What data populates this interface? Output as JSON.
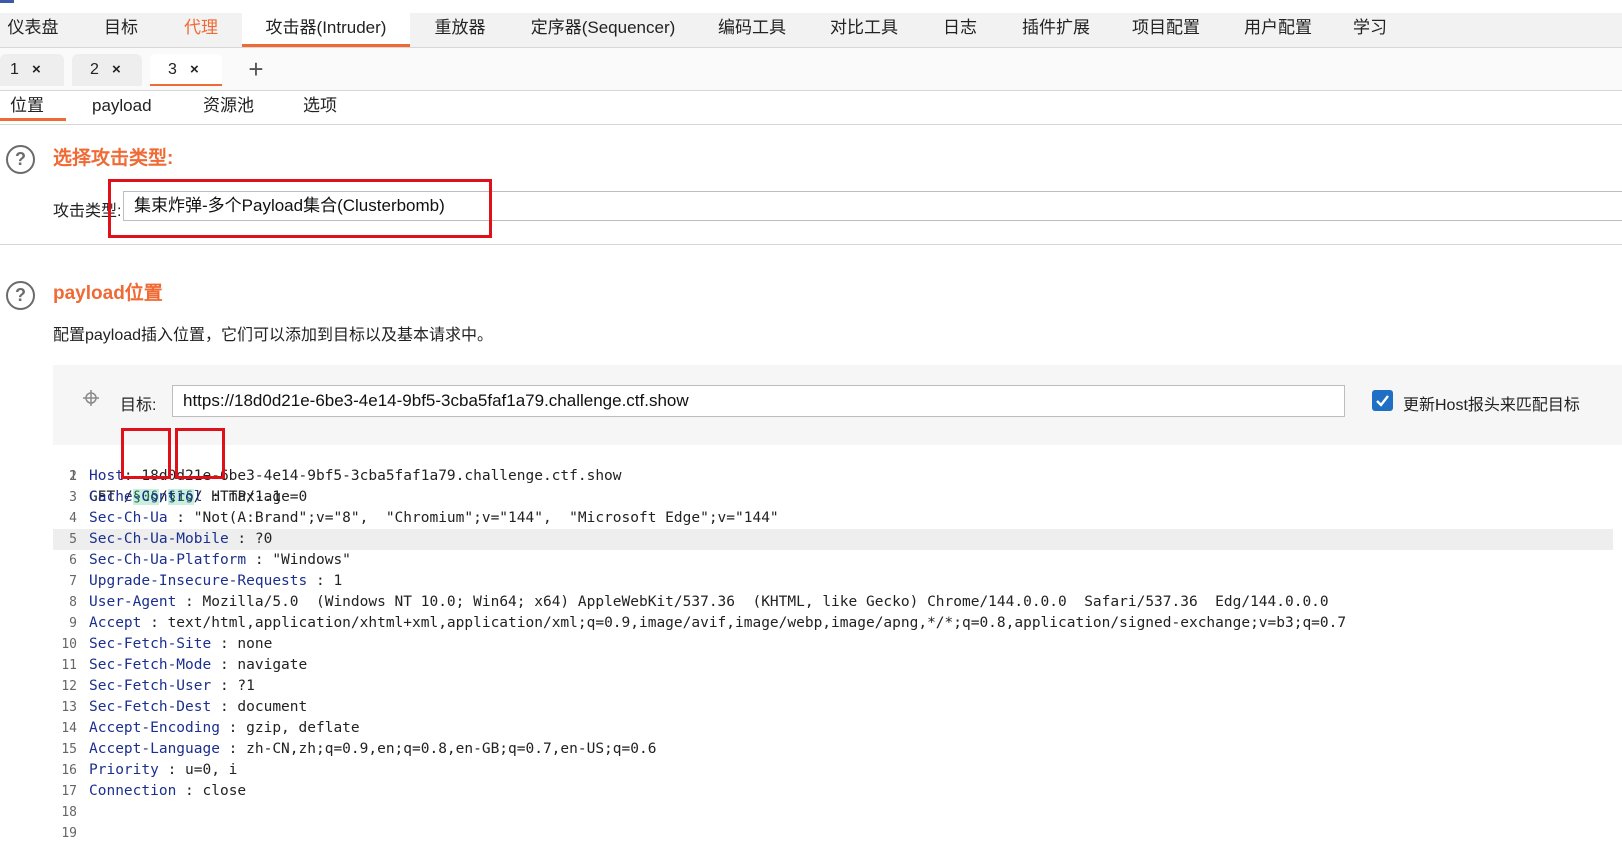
{
  "main_tabs": [
    "仪表盘",
    "目标",
    "代理",
    "攻击器(Intruder)",
    "重放器",
    "定序器(Sequencer)",
    "编码工具",
    "对比工具",
    "日志",
    "插件扩展",
    "项目配置",
    "用户配置",
    "学习"
  ],
  "num_tabs": [
    {
      "label": "1",
      "close": "×"
    },
    {
      "label": "2",
      "close": "×"
    },
    {
      "label": "3",
      "close": "×"
    }
  ],
  "add_tab": "+",
  "sub_tabs": [
    "位置",
    "payload",
    "资源池",
    "选项"
  ],
  "attack_section": {
    "help": "?",
    "title": "选择攻击类型:",
    "label": "攻击类型:",
    "value": "集束炸弹-多个Payload集合(Clusterbomb)"
  },
  "payload_section": {
    "help": "?",
    "title": "payload位置",
    "description": "配置payload插入位置，它们可以添加到目标以及基本请求中。"
  },
  "target": {
    "label": "目标:",
    "value": "https://18d0d21e-6be3-4e14-9bf5-3cba5faf1a79.challenge.ctf.show",
    "update_host_checked": true,
    "update_host_label": "更新Host报头来匹配目标"
  },
  "request": {
    "line1": {
      "ln": "1",
      "method": "GET /",
      "marker1": "§0§",
      "sep": "/",
      "marker2": "§1§",
      "rest": "/ HTTP/1.1"
    },
    "headers": [
      {
        "ln": "2",
        "name": "Host",
        "value": ": 18d0d21e-6be3-4e14-9bf5-3cba5faf1a79.challenge.ctf.show"
      },
      {
        "ln": "3",
        "name": "Cache-Control",
        "value": " : max-age=0"
      },
      {
        "ln": "4",
        "name": "Sec-Ch-Ua",
        "value": " : \"Not(A:Brand\";v=\"8\",  \"Chromium\";v=\"144\",  \"Microsoft Edge\";v=\"144\""
      },
      {
        "ln": "5",
        "name": "Sec-Ch-Ua-Mobile",
        "value": " : ?0"
      },
      {
        "ln": "6",
        "name": "Sec-Ch-Ua-Platform",
        "value": " : \"Windows\""
      },
      {
        "ln": "7",
        "name": "Upgrade-Insecure-Requests",
        "value": " : 1"
      },
      {
        "ln": "8",
        "name": "User-Agent",
        "value": " : Mozilla/5.0  (Windows NT 10.0; Win64; x64) AppleWebKit/537.36  (KHTML, like Gecko) Chrome/144.0.0.0  Safari/537.36  Edg/144.0.0.0"
      },
      {
        "ln": "9",
        "name": "Accept",
        "value": " : text/html,application/xhtml+xml,application/xml;q=0.9,image/avif,image/webp,image/apng,*/*;q=0.8,application/signed-exchange;v=b3;q=0.7"
      },
      {
        "ln": "10",
        "name": "Sec-Fetch-Site",
        "value": " : none"
      },
      {
        "ln": "11",
        "name": "Sec-Fetch-Mode",
        "value": " : navigate"
      },
      {
        "ln": "12",
        "name": "Sec-Fetch-User",
        "value": " : ?1"
      },
      {
        "ln": "13",
        "name": "Sec-Fetch-Dest",
        "value": " : document"
      },
      {
        "ln": "14",
        "name": "Accept-Encoding",
        "value": " : gzip, deflate"
      },
      {
        "ln": "15",
        "name": "Accept-Language",
        "value": " : zh-CN,zh;q=0.9,en;q=0.8,en-GB;q=0.7,en-US;q=0.6"
      },
      {
        "ln": "16",
        "name": "Priority",
        "value": " : u=0, i"
      },
      {
        "ln": "17",
        "name": "Connection",
        "value": " : close"
      }
    ],
    "empty_lines": [
      "18",
      "19"
    ]
  },
  "colors": {
    "accent": "#f06a35",
    "highlight_box": "#e0101a",
    "checkbox": "#1f6fc5",
    "header_name": "#1b2f8e",
    "marker_bg": "#cbeee0"
  }
}
